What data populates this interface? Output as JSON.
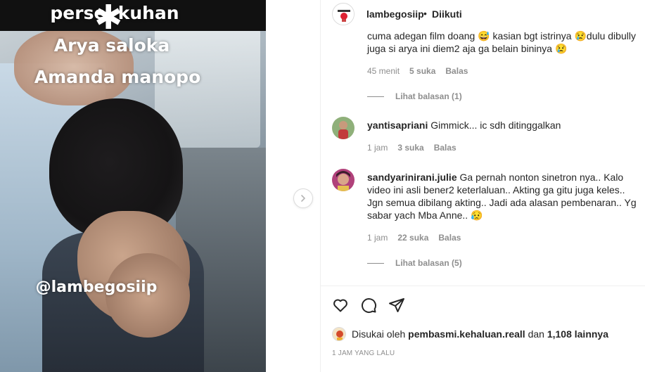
{
  "media": {
    "caption_top": "persel kuhan",
    "name_1": "Arya saloka",
    "name_2": "Amanda manopo",
    "watermark": "@lambegosiip"
  },
  "post": {
    "author": "lambegosiip",
    "separator": "•",
    "follow_status": "Diikuti"
  },
  "comments": [
    {
      "text": "cuma adegan film doang 😅 kasian bgt istrinya 😢dulu dibully juga si arya ini diem2 aja ga belain bininya 😢",
      "time": "45 menit",
      "likes": "5 suka",
      "reply": "Balas",
      "view_replies": "Lihat balasan (1)"
    },
    {
      "user": "yantisapriani",
      "text": "Gimmick... ic sdh ditinggalkan",
      "time": "1 jam",
      "likes": "3 suka",
      "reply": "Balas"
    },
    {
      "user": "sandyarinirani.julie",
      "text": "Ga pernah nonton sinetron nya.. Kalo video ini asli bener2 keterlaluan.. Akting ga gitu juga keles.. Jgn semua dibilang akting.. Jadi ada alasan pembenaran.. Yg sabar yach Mba Anne.. 😥",
      "time": "1 jam",
      "likes": "22 suka",
      "reply": "Balas",
      "view_replies": "Lihat balasan (5)"
    }
  ],
  "likes_line": {
    "prefix": "Disukai oleh",
    "user": "pembasmi.kehaluan.reall",
    "middle": "dan",
    "count": "1,108 lainnya"
  },
  "timestamp": "1 JAM YANG LALU"
}
